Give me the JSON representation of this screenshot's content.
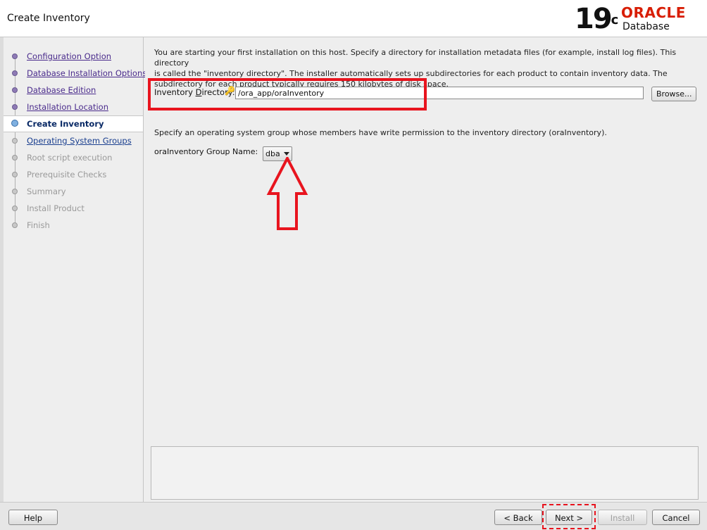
{
  "header": {
    "title": "Create Inventory",
    "brand_version": "19",
    "brand_version_sup": "c",
    "brand_name": "ORACLE",
    "brand_product": "Database"
  },
  "colors": {
    "accent_red": "#d81e05",
    "annotation": "#e8141e",
    "link": "#4a2b8c"
  },
  "steps": [
    {
      "label": "Configuration Option",
      "state": "done"
    },
    {
      "label": "Database Installation Options",
      "state": "done"
    },
    {
      "label": "Database Edition",
      "state": "done"
    },
    {
      "label": "Installation Location",
      "state": "done"
    },
    {
      "label": "Create Inventory",
      "state": "current"
    },
    {
      "label": "Operating System Groups",
      "state": "link"
    },
    {
      "label": "Root script execution",
      "state": "disabled"
    },
    {
      "label": "Prerequisite Checks",
      "state": "disabled"
    },
    {
      "label": "Summary",
      "state": "disabled"
    },
    {
      "label": "Install Product",
      "state": "disabled"
    },
    {
      "label": "Finish",
      "state": "disabled"
    }
  ],
  "main": {
    "intro_line1": "You are starting your first installation on this host. Specify a directory for installation metadata files (for example, install log files). This directory",
    "intro_line2": "is called the \"inventory directory\". The installer automatically sets up subdirectories for each product to contain inventory data. The",
    "intro_line3": "subdirectory for each product typically requires 150 kilobytes of disk space.",
    "inventory_label_pre": "Inventory ",
    "inventory_label_mnemonic": "D",
    "inventory_label_post": "irectory:",
    "inventory_value": "/ora_app/oraInventory",
    "browse_label": "Browse...",
    "group_desc": "Specify an operating system group whose members have write permission to the inventory directory (oraInventory).",
    "group_label": "oraInventory Group Name:",
    "group_value": "dba"
  },
  "footer": {
    "help_label": "Help",
    "back_label": "< Back",
    "next_label": "Next >",
    "install_label": "Install",
    "cancel_label": "Cancel"
  }
}
